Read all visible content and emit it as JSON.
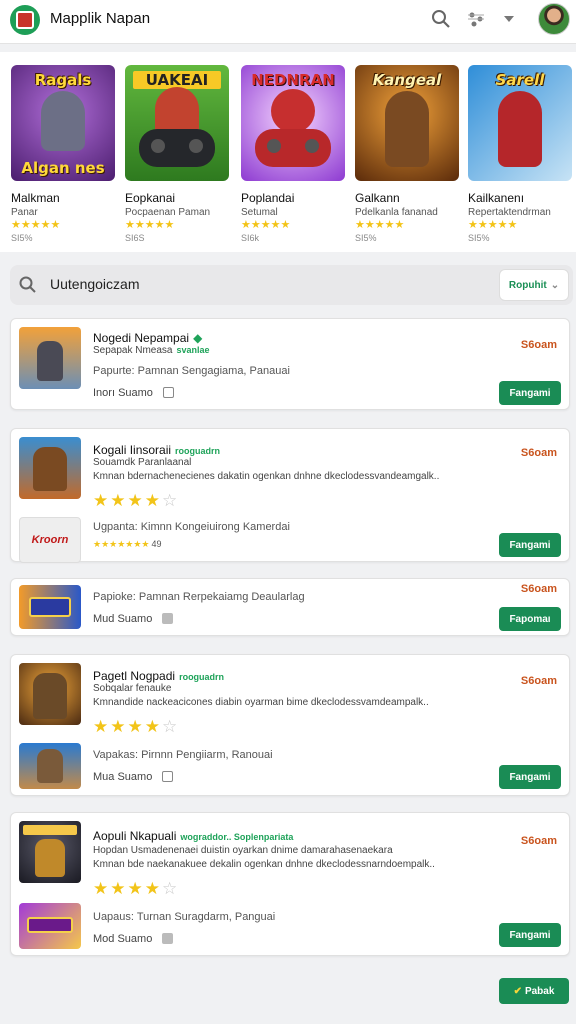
{
  "header": {
    "title": "Mapplik Napan"
  },
  "featured": [
    {
      "name": "Malkman",
      "sub": "Panar",
      "stars": "★★★★★",
      "price": "SI5%",
      "top": "Ragals",
      "bottom": "Algan nes"
    },
    {
      "name": "Eopkanai",
      "sub": "Pocpaenan Paman",
      "stars": "★★★★★",
      "price": "SI6S",
      "top": "UAKEAI",
      "bottom": ""
    },
    {
      "name": "Poplandai",
      "sub": "Setumal",
      "stars": "★★★★★",
      "price": "SI6k",
      "top": "NEDNRAN",
      "bottom": ""
    },
    {
      "name": "Galkann",
      "sub": "Pdelkanla fananad",
      "stars": "★★★★★",
      "price": "SI5%",
      "top": "Kangeal",
      "bottom": ""
    },
    {
      "name": "Kailkanenı",
      "sub": "Repertaktendrman",
      "stars": "★★★★★",
      "price": "SI5%",
      "top": "Sarell",
      "bottom": ""
    }
  ],
  "search": {
    "value": "Uutengoiczam",
    "sort_label": "Ropuhit"
  },
  "list": [
    {
      "title": "Nogedi Nepampai",
      "badge": "",
      "sub": "Sepapak Nmeasa",
      "sub_badge": "svanlae",
      "meta": "Papurte: Pamnan  Sengagiama, Panauai",
      "meta2": "Inorı Suamo",
      "price": "S6oam",
      "button": "Fangami"
    },
    {
      "title": "Kogali Iinsoraii",
      "badge": "rooguadrn",
      "sub": "Souamdk Paranlaanal",
      "desc": "Kmnan bdernachenecienes dakatin ogenkan dnhne dkeclodessvandeamgalk..",
      "stars_full": "★★★★",
      "stars_empty": "☆",
      "meta": "Ugpanta: Kimnn  Kongeiuirong Kamerdai",
      "small_stars": "★★★★★★★",
      "small_rating": "49",
      "sub_thumb": "Kroorn",
      "price": "S6oam",
      "button": "Fangami"
    },
    {
      "title": "Papioke: Pamnan  Rerpekaiamg Deaularlag",
      "meta2": "Mud Suamo",
      "price": "S6oam",
      "button": "Fapomaı"
    },
    {
      "title": "Pagetl Nogpadi",
      "badge": "rooguadrn",
      "sub": "Sobqalar fenauke",
      "desc": "Kmnandide nackeacicones diabin oyarman bime dkeclodessvamdeampalk..",
      "stars_full": "★★★★",
      "stars_empty": "☆",
      "meta": "Vapakas: Pirnnn  Pengiiarm, Ranouai",
      "meta2": "Mua Suamo",
      "price": "S6oam",
      "button": "Fangami"
    },
    {
      "title": "Aopuli Nkapuali",
      "badge": "wograddor..  Soplenpariata",
      "sub": "Hopdan Usmadenenaei duistin oyarkan dnime damarahasenaekara",
      "desc": "Kmnan bde naekanakuee dekalin ogenkan dnhne dkeclodessnarndoempalk..",
      "stars_full": "★★★★",
      "stars_empty": "☆",
      "meta": "Uapaus: Turnan  Suragdarm, Panguai",
      "meta2": "Mod Suamo",
      "price": "S6oam",
      "button": "Fangami"
    }
  ],
  "fab": {
    "label": "Pabak"
  },
  "colors": {
    "accent": "#1a8c55",
    "price": "#c9541e",
    "star": "#f2c419"
  }
}
